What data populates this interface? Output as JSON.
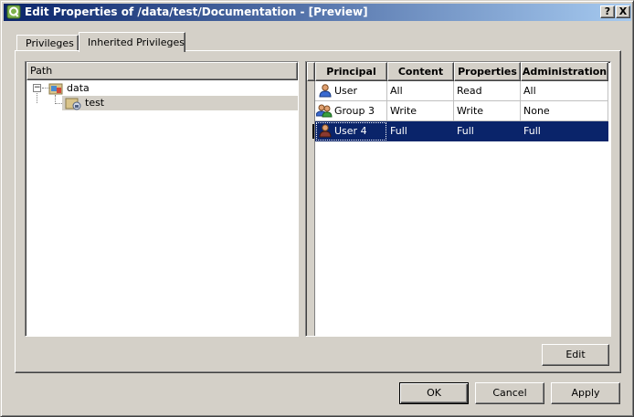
{
  "window": {
    "title": "Edit Properties of /data/test/Documentation - [Preview]",
    "help_button": "?",
    "close_button": "X"
  },
  "tabs": [
    {
      "label": "Privileges",
      "active": false
    },
    {
      "label": "Inherited Privileges",
      "active": true
    }
  ],
  "tree": {
    "header": "Path",
    "nodes": [
      {
        "label": "data",
        "expanded": true,
        "icon": "folder-icon"
      },
      {
        "label": "test",
        "selected": true,
        "icon": "folder-lock-icon"
      }
    ]
  },
  "table": {
    "columns": [
      "Principal",
      "Content",
      "Properties",
      "Administration"
    ],
    "rows": [
      {
        "principal": "User",
        "content": "All",
        "properties": "Read",
        "administration": "All",
        "icon": "user-icon",
        "selected": false
      },
      {
        "principal": "Group 3",
        "content": "Write",
        "properties": "Write",
        "administration": "None",
        "icon": "group-icon",
        "selected": false
      },
      {
        "principal": "User 4",
        "content": "Full",
        "properties": "Full",
        "administration": "Full",
        "icon": "user-icon",
        "selected": true
      }
    ]
  },
  "buttons": {
    "edit": "Edit",
    "ok": "OK",
    "cancel": "Cancel",
    "apply": "Apply"
  },
  "colors": {
    "selection": "#0a246a",
    "face": "#d4d0c8",
    "title_start": "#0a246a",
    "title_end": "#a6caf0"
  }
}
